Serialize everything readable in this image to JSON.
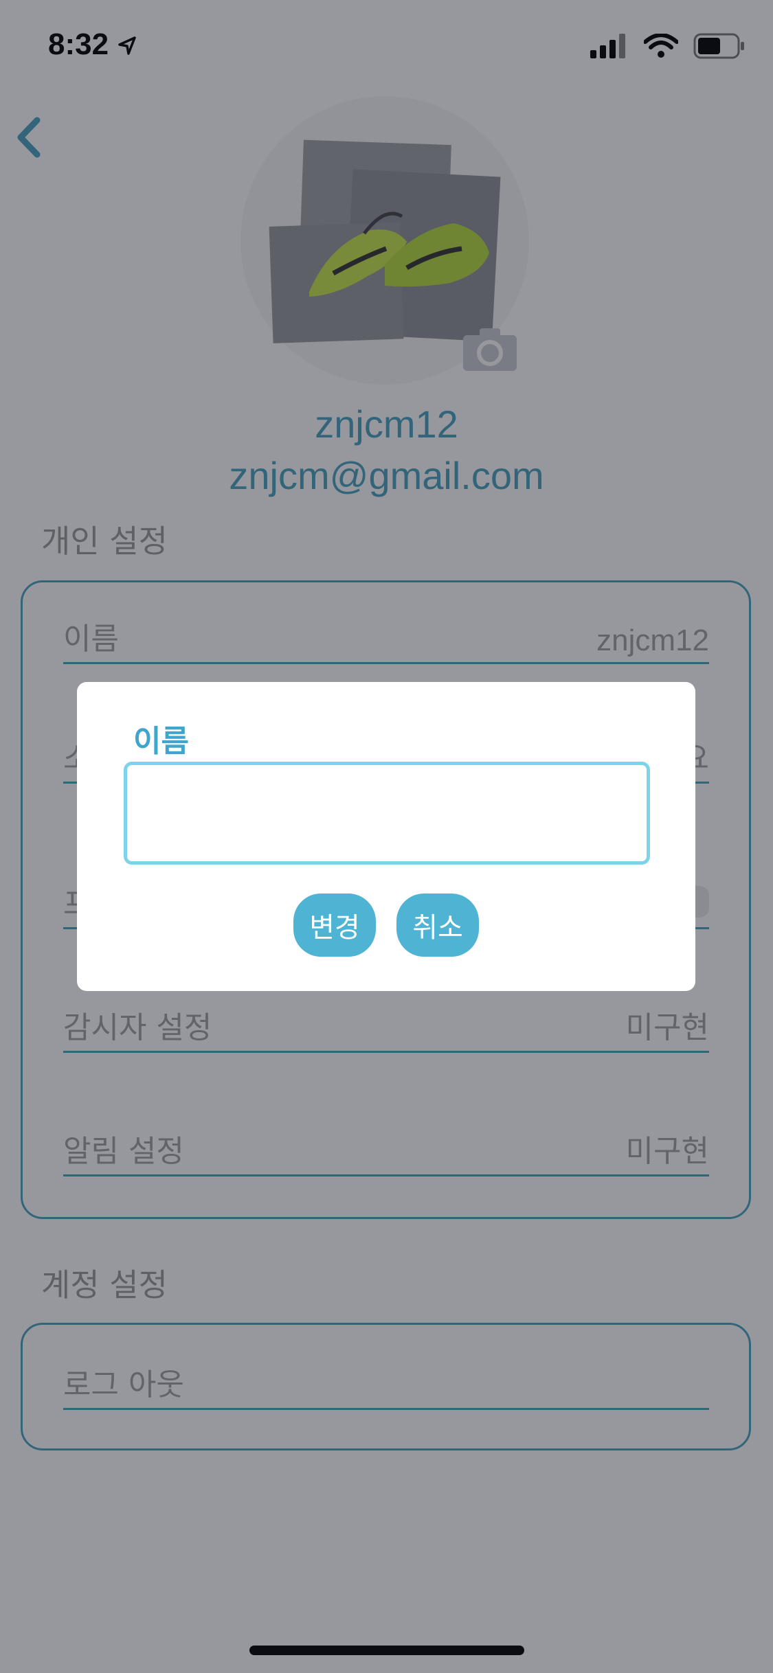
{
  "status": {
    "time": "8:32"
  },
  "profile": {
    "username": "znjcm12",
    "email": "znjcm@gmail.com"
  },
  "personal": {
    "title": "개인 설정",
    "rows": [
      {
        "label": "이름",
        "value": "znjcm12"
      },
      {
        "label": "소",
        "value": "요"
      },
      {
        "label": "프",
        "value": ""
      },
      {
        "label": "감시자 설정",
        "value": "미구현"
      },
      {
        "label": "알림 설정",
        "value": "미구현"
      }
    ]
  },
  "account": {
    "title": "계정 설정",
    "logout_label": "로그 아웃"
  },
  "dialog": {
    "title": "이름",
    "input_value": "",
    "confirm_label": "변경",
    "cancel_label": "취소"
  },
  "icons": {
    "back": "chevron-left-icon",
    "camera": "camera-icon",
    "location": "location-arrow-icon",
    "signal": "cellular-signal-icon",
    "wifi": "wifi-icon",
    "battery": "battery-icon"
  },
  "colors": {
    "accent": "#4aa2c0",
    "input_border": "#7dd4ea",
    "button": "#4fb4d3"
  }
}
